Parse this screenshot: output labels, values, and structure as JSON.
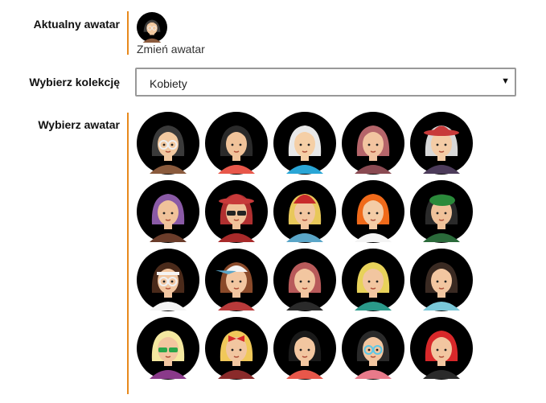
{
  "current": {
    "label": "Aktualny awatar",
    "change_link": "Zmień awatar"
  },
  "collection": {
    "label": "Wybierz kolekcję",
    "selected": "Kobiety",
    "caret": "▼"
  },
  "chooser": {
    "label": "Wybierz awatar",
    "avatars": [
      {
        "hair": "#3a3a3a",
        "skin": "#f2c9a0",
        "shirt": "#8a5a3c",
        "acc": "glasses"
      },
      {
        "hair": "#2a2a2a",
        "skin": "#f0c39a",
        "shirt": "#e8574a",
        "acc": "none"
      },
      {
        "hair": "#e8e8e8",
        "skin": "#f5cfa6",
        "shirt": "#2aa6d6",
        "acc": "none"
      },
      {
        "hair": "#b5656a",
        "skin": "#f2c4a0",
        "shirt": "#8a4a52",
        "acc": "none"
      },
      {
        "hair": "#d8d8d8",
        "skin": "#f4cca6",
        "shirt": "#4c3b5a",
        "acc": "hat-red"
      },
      {
        "hair": "#8a5aa6",
        "skin": "#f0c29a",
        "shirt": "#6a3c2a",
        "acc": "none"
      },
      {
        "hair": "#b03030",
        "skin": "#f0c29a",
        "shirt": "#a82a2a",
        "acc": "hat-red-sunglasses"
      },
      {
        "hair": "#e8c85a",
        "skin": "#f2c6a0",
        "shirt": "#5aa6c8",
        "acc": "beanie-red"
      },
      {
        "hair": "#f06a1a",
        "skin": "#f4cca6",
        "shirt": "#f4f4f4",
        "acc": "none"
      },
      {
        "hair": "#2a2a2a",
        "skin": "#f0c29a",
        "shirt": "#2a6a3a",
        "acc": "beret-green"
      },
      {
        "hair": "#4a2a1a",
        "skin": "#f2c6a0",
        "shirt": "#f4f4f4",
        "acc": "headband-glasses"
      },
      {
        "hair": "#8a4a2a",
        "skin": "#f2c6a0",
        "shirt": "#b83a3a",
        "acc": "cap-white"
      },
      {
        "hair": "#b85a5a",
        "skin": "#f2c6a0",
        "shirt": "#2a2a2a",
        "acc": "none"
      },
      {
        "hair": "#e8d25a",
        "skin": "#f2c6a0",
        "shirt": "#2a9a8a",
        "acc": "none"
      },
      {
        "hair": "#3a2a22",
        "skin": "#f2c6a0",
        "shirt": "#7ac8d8",
        "acc": "none"
      },
      {
        "hair": "#f4e8a0",
        "skin": "#f2c6a0",
        "shirt": "#8a3a8a",
        "acc": "sunglasses-green"
      },
      {
        "hair": "#f0c85a",
        "skin": "#f2c6a0",
        "shirt": "#8a2a2a",
        "acc": "bow-red"
      },
      {
        "hair": "#1a1a1a",
        "skin": "#f2c6a0",
        "shirt": "#e8574a",
        "acc": "none"
      },
      {
        "hair": "#2a2a2a",
        "skin": "#f2c6a0",
        "shirt": "#e87a8a",
        "acc": "glasses-blue"
      },
      {
        "hair": "#d8282a",
        "skin": "#f2c6a0",
        "shirt": "#2a2a2a",
        "acc": "none"
      }
    ]
  },
  "colors": {
    "accent": "#e8891c",
    "circle": "#000000"
  }
}
